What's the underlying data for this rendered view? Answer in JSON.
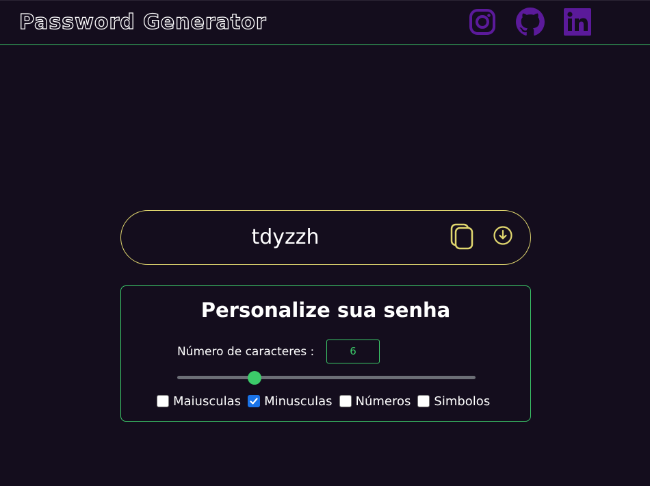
{
  "header": {
    "logo": "Password Generator",
    "social": [
      {
        "icon": "instagram-icon",
        "color": "#5b1a9a"
      },
      {
        "icon": "github-icon",
        "color": "#5b1a9a"
      },
      {
        "icon": "linkedin-icon",
        "color": "#5b1a9a"
      }
    ]
  },
  "password": {
    "value": "tdyzzh",
    "copy_icon": "copy-icon",
    "download_icon": "download-icon",
    "accent": "#e1d76f"
  },
  "panel": {
    "title": "Personalize sua senha",
    "length_label": "Número de caracteres :",
    "length_value": "6",
    "slider_fraction": 0.26,
    "accent": "#3ccb6a",
    "options": [
      {
        "label": "Maiusculas",
        "checked": false
      },
      {
        "label": "Minusculas",
        "checked": true
      },
      {
        "label": "Números",
        "checked": false
      },
      {
        "label": "Simbolos",
        "checked": false
      }
    ]
  }
}
